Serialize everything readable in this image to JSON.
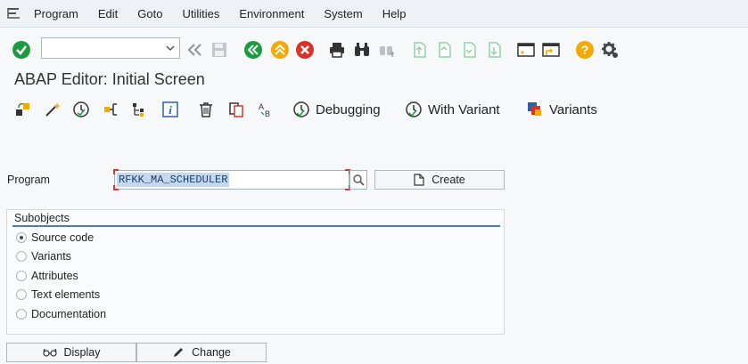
{
  "menu": [
    "Program",
    "Edit",
    "Goto",
    "Utilities",
    "Environment",
    "System",
    "Help"
  ],
  "command_field": {
    "value": ""
  },
  "title": "ABAP Editor: Initial Screen",
  "app_toolbar": {
    "debugging": "Debugging",
    "with_variant": "With Variant",
    "variants": "Variants"
  },
  "program": {
    "label": "Program",
    "value": "RFKK_MA_SCHEDULER",
    "create_label": "Create"
  },
  "subobjects": {
    "title": "Subobjects",
    "options": [
      "Source code",
      "Variants",
      "Attributes",
      "Text elements",
      "Documentation"
    ],
    "selected": "Source code"
  },
  "buttons": {
    "display": "Display",
    "change": "Change"
  },
  "colors": {
    "accent": "#4a7fb5",
    "green": "#1c9a3f",
    "orange": "#f2a900",
    "red": "#d8322a"
  }
}
